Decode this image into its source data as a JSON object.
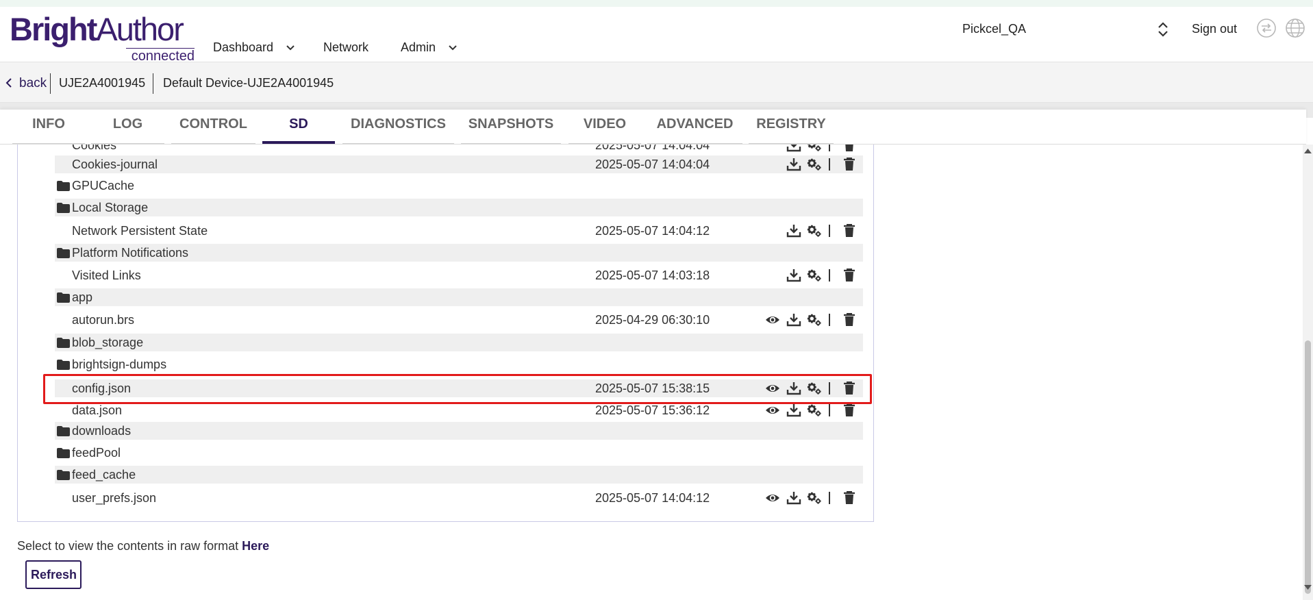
{
  "header": {
    "brand_bold": "Bright",
    "brand_light": "Author",
    "brand_sub": "connected",
    "nav": [
      {
        "label": "Dashboard"
      },
      {
        "label": "Network"
      },
      {
        "label": "Admin"
      }
    ],
    "account": "Pickcel_QA",
    "sign_out": "Sign out"
  },
  "breadcrumb": {
    "back": "back",
    "device_id": "UJE2A4001945",
    "device_name": "Default Device-UJE2A4001945"
  },
  "tabs": [
    {
      "label": "INFO"
    },
    {
      "label": "LOG"
    },
    {
      "label": "CONTROL"
    },
    {
      "label": "SD",
      "active": true
    },
    {
      "label": "DIAGNOSTICS"
    },
    {
      "label": "SNAPSHOTS"
    },
    {
      "label": "VIDEO"
    },
    {
      "label": "ADVANCED"
    },
    {
      "label": "REGISTRY"
    }
  ],
  "files": [
    {
      "name": "Cookies",
      "date": "2025-05-07 14:04:04",
      "folder": false,
      "view": false
    },
    {
      "name": "Cookies-journal",
      "date": "2025-05-07 14:04:04",
      "folder": false,
      "view": false
    },
    {
      "name": "GPUCache",
      "date": "",
      "folder": true,
      "view": false
    },
    {
      "name": "Local Storage",
      "date": "",
      "folder": true,
      "view": false
    },
    {
      "name": "Network Persistent State",
      "date": "2025-05-07 14:04:12",
      "folder": false,
      "view": false
    },
    {
      "name": "Platform Notifications",
      "date": "",
      "folder": true,
      "view": false
    },
    {
      "name": "Visited Links",
      "date": "2025-05-07 14:03:18",
      "folder": false,
      "view": false
    },
    {
      "name": "app",
      "date": "",
      "folder": true,
      "view": false
    },
    {
      "name": "autorun.brs",
      "date": "2025-04-29 06:30:10",
      "folder": false,
      "view": true
    },
    {
      "name": "blob_storage",
      "date": "",
      "folder": true,
      "view": false
    },
    {
      "name": "brightsign-dumps",
      "date": "",
      "folder": true,
      "view": false
    },
    {
      "name": "config.json",
      "date": "2025-05-07 15:38:15",
      "folder": false,
      "view": true
    },
    {
      "name": "data.json",
      "date": "2025-05-07 15:36:12",
      "folder": false,
      "view": true
    },
    {
      "name": "downloads",
      "date": "",
      "folder": true,
      "view": false
    },
    {
      "name": "feedPool",
      "date": "",
      "folder": true,
      "view": false
    },
    {
      "name": "feed_cache",
      "date": "",
      "folder": true,
      "view": false
    },
    {
      "name": "user_prefs.json",
      "date": "2025-05-07 14:04:12",
      "folder": false,
      "view": true
    }
  ],
  "raw": {
    "text": "Select to view the contents in raw format",
    "link": "Here"
  },
  "refresh_label": "Refresh",
  "icons": {
    "folder": "folder-icon",
    "view": "eye-icon",
    "download": "download-icon",
    "settings": "gears-icon",
    "delete": "trash-icon"
  }
}
